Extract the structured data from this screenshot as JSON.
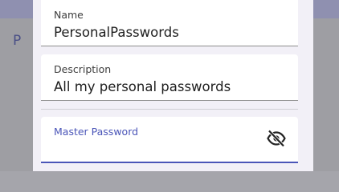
{
  "backdrop": {
    "partial_title": "P"
  },
  "form": {
    "name": {
      "label": "Name",
      "value": "PersonalPasswords"
    },
    "description": {
      "label": "Description",
      "value": "All my personal passwords"
    },
    "master_password": {
      "label": "Master Password",
      "value": "",
      "visibility_icon": "eye-off-icon"
    }
  },
  "colors": {
    "accent": "#4a55b8",
    "dialog_bg": "#f2f0f7",
    "field_bg": "#ffffff"
  }
}
